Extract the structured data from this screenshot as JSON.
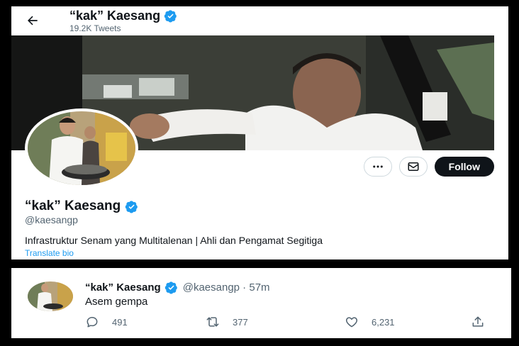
{
  "header": {
    "name": "“kak” Kaesang",
    "tweet_count": "19.2K Tweets"
  },
  "profile": {
    "display_name": "“kak” Kaesang",
    "handle": "@kaesangp",
    "bio": "Infrastruktur Senam yang Multitalenan | Ahli dan Pengamat Segitiga",
    "translate_label": "Translate bio",
    "follow_label": "Follow",
    "more_icon": "more-icon",
    "message_icon": "envelope-icon"
  },
  "tweet": {
    "name": "“kak” Kaesang",
    "handle_time": "@kaesangp · 57m",
    "text": "Asem gempa",
    "replies": "491",
    "retweets": "377",
    "likes": "6,231"
  },
  "colors": {
    "accent": "#1d9bf0",
    "text": "#0f1419",
    "muted": "#536471"
  }
}
